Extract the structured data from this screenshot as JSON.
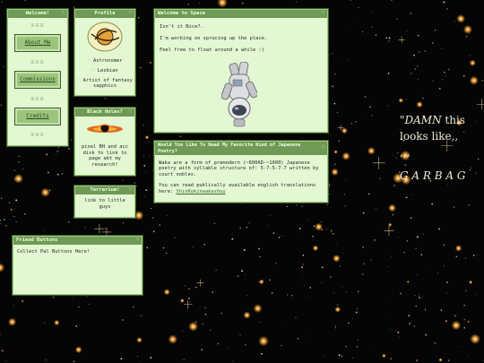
{
  "nav": {
    "title": "Welcome!",
    "about": "About Me",
    "commissions": "Commissions",
    "credits": "Credits",
    "ornament": "ꕤꕤꕤ"
  },
  "profile": {
    "title": "Profile",
    "items": [
      "Astronomer",
      "Lesbian",
      "Artist of fantasy sapphics"
    ]
  },
  "blackholes": {
    "title": "Black Holes?",
    "text": "pixel BH and acc disk to link to page abt my research!"
  },
  "terrarium": {
    "title": "Terrarium!",
    "text": "link to little guys"
  },
  "friends": {
    "title": "Friend Buttons",
    "text": "Collect Pal Buttons Here!"
  },
  "welcome": {
    "title": "Welcome to Space",
    "lines": [
      "Isn't it Nice?.",
      "I'm working on sprucing up the place.",
      "Feel free to float around a while :)"
    ]
  },
  "poetry": {
    "title": "Would You Like To Read My Favorite Kind of Japanese Poetry?",
    "para1": "Waka are a form of premodern (~600AD-~1600) Japanese poetry with syllable structure of: 5-7-5-7-7 written by court nobles.",
    "para2_prefix": "You can read publically available english translations here: ",
    "link": "ShinKokinwakashuu"
  },
  "quote": {
    "line1_em": "\"DAMN",
    "line1_rest": " this",
    "line2": "looks like,,",
    "line3": ",,,",
    "line4": "G A R B A G"
  },
  "icons": {
    "window": "heart-icon",
    "list": "heart-bullet-icon",
    "profile": "saturn-avatar-icon",
    "blackhole": "black-hole-icon",
    "astronaut": "astronaut-image"
  },
  "colors": {
    "window_bg": "#e2f7d2",
    "title_bar": "#6f9a55",
    "button": "#9bc57c",
    "background": "#050505"
  }
}
